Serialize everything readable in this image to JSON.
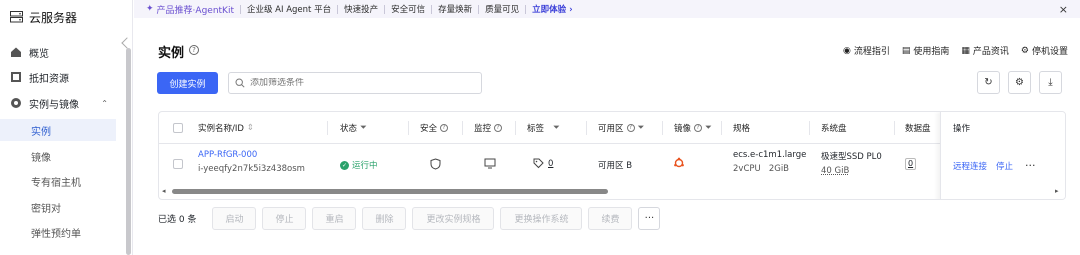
{
  "sidebar": {
    "title": "云服务器",
    "items": [
      {
        "label": "概览",
        "icon": "home-icon"
      },
      {
        "label": "抵扣资源",
        "icon": "discount-icon"
      },
      {
        "label": "实例与镜像",
        "icon": "instance-icon"
      },
      {
        "label": "实例"
      },
      {
        "label": "镜像"
      },
      {
        "label": "专有宿主机"
      },
      {
        "label": "密钥对"
      },
      {
        "label": "弹性预约单"
      }
    ]
  },
  "banner": {
    "promo": "产品推荐·AgentKit",
    "items": [
      "企业级 AI Agent 平台",
      "快速投产",
      "安全可信",
      "存量焕新",
      "质量可见"
    ],
    "cta": "立即体验",
    "close": "×"
  },
  "header": {
    "title": "实例",
    "links": [
      "流程指引",
      "使用指南",
      "产品资讯",
      "停机设置"
    ]
  },
  "toolbar": {
    "create_label": "创建实例",
    "search_placeholder": "添加筛选条件"
  },
  "table": {
    "columns": [
      "实例名称/ID",
      "状态",
      "安全",
      "监控",
      "标签",
      "可用区",
      "镜像",
      "规格",
      "系统盘",
      "数据盘",
      "操作"
    ],
    "row": {
      "name": "APP-RfGR-000",
      "id": "i-yeeqfy2n7k5i3z438osm",
      "status": "运行中",
      "tags": "0",
      "zone": "可用区 B",
      "spec": "ecs.e-c1m1.large",
      "spec_detail": "2vCPU   2GiB",
      "disk_type": "极速型SSD PL0",
      "disk_size": "40 GiB",
      "data_disk": "0",
      "action_connect": "远程连接",
      "action_stop": "停止",
      "more": "···"
    }
  },
  "bottom": {
    "selected": "已选 0 条",
    "buttons": [
      "启动",
      "停止",
      "重启",
      "删除",
      "更改实例规格",
      "更换操作系统",
      "续费"
    ],
    "more": "···"
  }
}
